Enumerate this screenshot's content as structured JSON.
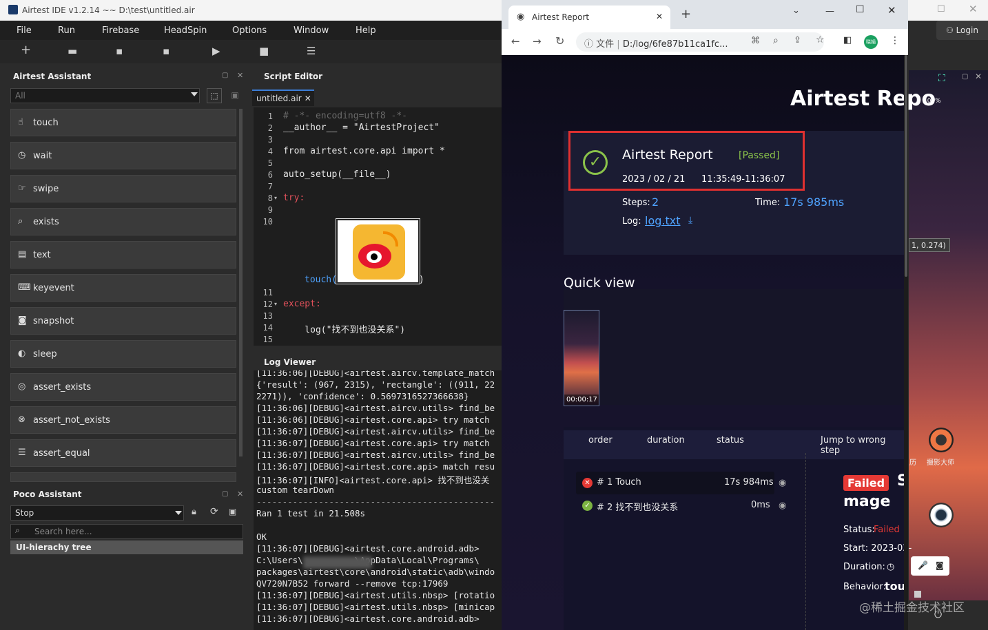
{
  "ide": {
    "title": "Airtest IDE v1.2.14 ~~ D:\\test\\untitled.air",
    "menu": [
      "File",
      "Run",
      "Firebase",
      "HeadSpin",
      "Options",
      "Window",
      "Help"
    ],
    "login": "Login"
  },
  "assistant": {
    "title": "Airtest Assistant",
    "filter": "All",
    "items": [
      {
        "label": "touch",
        "icon": "hand-icon"
      },
      {
        "label": "wait",
        "icon": "clock-icon"
      },
      {
        "label": "swipe",
        "icon": "swipe-icon"
      },
      {
        "label": "exists",
        "icon": "search-icon"
      },
      {
        "label": "text",
        "icon": "text-icon"
      },
      {
        "label": "keyevent",
        "icon": "keyboard-icon"
      },
      {
        "label": "snapshot",
        "icon": "camera-icon"
      },
      {
        "label": "sleep",
        "icon": "moon-icon"
      },
      {
        "label": "assert_exists",
        "icon": "target-icon"
      },
      {
        "label": "assert_not_exists",
        "icon": "cross-target-icon"
      },
      {
        "label": "assert_equal",
        "icon": "equal-icon"
      }
    ]
  },
  "poco": {
    "title": "Poco Assistant",
    "mode": "Stop",
    "search_placeholder": "Search here...",
    "tree": "UI-hierachy tree"
  },
  "editor": {
    "title": "Script Editor",
    "tab": "untitled.air",
    "lines": [
      {
        "n": "1",
        "code": "# -*- encoding=utf8 -*-"
      },
      {
        "n": "2",
        "code": "__author__ = \"AirtestProject\""
      },
      {
        "n": "3",
        "code": ""
      },
      {
        "n": "4",
        "code": "from airtest.core.api import *"
      },
      {
        "n": "5",
        "code": ""
      },
      {
        "n": "6",
        "code": "auto_setup(__file__)"
      },
      {
        "n": "7",
        "code": ""
      },
      {
        "n": "8",
        "code": "try:"
      },
      {
        "n": "9",
        "code": ""
      },
      {
        "n": "10",
        "code": ""
      },
      {
        "n": "11",
        "code": ""
      },
      {
        "n": "12",
        "code": "except:"
      },
      {
        "n": "13",
        "code": ""
      },
      {
        "n": "14",
        "code": "    log(\"找不到也没关系\")"
      },
      {
        "n": "15",
        "code": ""
      }
    ],
    "touch_call": "touch(",
    "touch_close": ")"
  },
  "log": {
    "title": "Log Viewer",
    "lines": [
      "[11:36:06][DEBUG]<airtest.aircv.template_match",
      "{'result': (967, 2315), 'rectangle': ((911, 22",
      "2271)), 'confidence': 0.5697316527366638}",
      "[11:36:06][DEBUG]<airtest.aircv.utils> find_be",
      "[11:36:06][DEBUG]<airtest.core.api> try match ",
      "[11:36:07][DEBUG]<airtest.aircv.utils> find_be",
      "[11:36:07][DEBUG]<airtest.core.api> try match ",
      "[11:36:07][DEBUG]<airtest.aircv.utils> find_be",
      "[11:36:07][DEBUG]<airtest.core.api> match resu",
      "[11:36:07][INFO]<airtest.core.api> 找不到也没关",
      "custom tearDown",
      "----------------------------------------------",
      "Ran 1 test in 21.508s",
      "",
      "OK",
      "[11:36:07][DEBUG]<airtest.core.android.adb>",
      "C:\\Users\\          \\AppData\\Local\\Programs\\",
      "packages\\airtest\\core\\android\\static\\adb\\windo",
      "QV720N7B52 forward --remove tcp:17969",
      "[11:36:07][DEBUG]<airtest.utils.nbsp> [rotatio",
      "[11:36:07][DEBUG]<airtest.utils.nbsp> [minicap",
      "[11:36:07][DEBUG]<airtest.core.android.adb>"
    ]
  },
  "browser": {
    "tab_title": "Airtest Report",
    "url_prefix": "文件",
    "url": "D:/log/6fe87b11ca1fc...",
    "profile": "晓娟"
  },
  "report": {
    "heading": "Airtest Repo",
    "card_title": "Airtest Report",
    "status": "[Passed]",
    "date": "2023 / 02 / 21",
    "time_range": "11:35:49-11:36:07",
    "steps_label": "Steps:",
    "steps_value": "2",
    "time_label": "Time:",
    "time_value": "17s 985ms",
    "log_label": "Log:",
    "log_link": "log.txt",
    "quick_view": "Quick view",
    "thumb_time": "00:00:17",
    "cols": [
      "order",
      "duration",
      "status"
    ],
    "jump": "Jump to wrong step",
    "steps": [
      {
        "name": "# 1 Touch",
        "duration": "17s 984ms",
        "ok": false
      },
      {
        "name": "# 2 找不到也没关系",
        "duration": "0ms",
        "ok": true
      }
    ],
    "failed_badge": "Failed",
    "detail_s": "S",
    "detail_title": "mage",
    "status_label": "Status:",
    "status_value": "Failed",
    "start_label": "Start: 2023-02-",
    "duration_label": "Duration:",
    "behavior_label": "Behavior:",
    "behavior_value": "tou"
  },
  "device": {
    "battery": "100%",
    "coord": "1, 0.274)",
    "app_label": "摄影大师",
    "app_label2": "历"
  },
  "watermark": "@稀土掘金技术社区"
}
